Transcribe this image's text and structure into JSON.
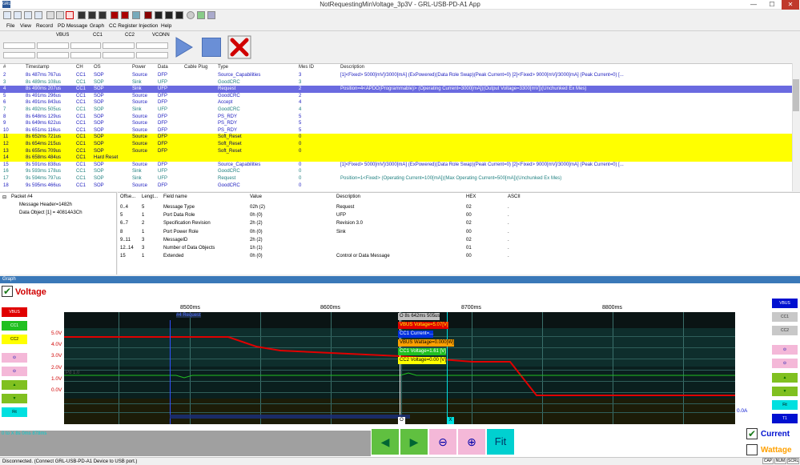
{
  "window": {
    "title": "NotRequestingMinVoltage_3p3V - GRL-USB-PD-A1 App",
    "icon_text": "GRL",
    "minimize": "—",
    "maximize": "☐",
    "close": "✕"
  },
  "menu": [
    "File",
    "View",
    "Record",
    "PD Message",
    "Graph",
    "CC Register Injection",
    "Help"
  ],
  "controls": {
    "labels": [
      "VBUS",
      "CC1",
      "CC2",
      "VCONN"
    ]
  },
  "table": {
    "headers": [
      "#",
      "Timestamp",
      "CH",
      "OS",
      "Power",
      "Data",
      "Cable Plug",
      "Type",
      "Mes ID",
      "Description"
    ],
    "rows": [
      {
        "n": "2",
        "ts": "8s 487ms 767us",
        "ch": "CC1",
        "os": "SOP",
        "power": "Source",
        "data": "DFP",
        "cable": "",
        "type": "Source_Capabilities",
        "mid": "3",
        "desc": "[1]<Fixed> 5000[mV]/3000[mA] (ExPowered)(Data Role Swap)(Peak Current=0) [2]<Fixed> 9000[mV]/3000[mA] (Peak Current=0) [...",
        "style": "blue"
      },
      {
        "n": "3",
        "ts": "8s 489ms 108us",
        "ch": "CC1",
        "os": "SOP",
        "power": "Sink",
        "data": "UFP",
        "cable": "",
        "type": "GoodCRC",
        "mid": "3",
        "desc": "",
        "style": "teal"
      },
      {
        "n": "4",
        "ts": "8s 490ms 207us",
        "ch": "CC1",
        "os": "SOP",
        "power": "Sink",
        "data": "UFP",
        "cable": "",
        "type": "Request",
        "mid": "2",
        "desc": "Position=4<APDO(Programmable)> (Operating Current=3000[mA])(Output Voltage=3300[mV])(Unchunked Ex Mes)",
        "style": "selected"
      },
      {
        "n": "5",
        "ts": "8s 491ms 296us",
        "ch": "CC1",
        "os": "SOP",
        "power": "Source",
        "data": "DFP",
        "cable": "",
        "type": "GoodCRC",
        "mid": "2",
        "desc": "",
        "style": "blue"
      },
      {
        "n": "6",
        "ts": "8s 491ms 843us",
        "ch": "CC1",
        "os": "SOP",
        "power": "Source",
        "data": "DFP",
        "cable": "",
        "type": "Accept",
        "mid": "4",
        "desc": "",
        "style": "blue"
      },
      {
        "n": "7",
        "ts": "8s 492ms 505us",
        "ch": "CC1",
        "os": "SOP",
        "power": "Sink",
        "data": "UFP",
        "cable": "",
        "type": "GoodCRC",
        "mid": "4",
        "desc": "",
        "style": "teal"
      },
      {
        "n": "8",
        "ts": "8s 648ms 129us",
        "ch": "CC1",
        "os": "SOP",
        "power": "Source",
        "data": "DFP",
        "cable": "",
        "type": "PS_RDY",
        "mid": "5",
        "desc": "",
        "style": "blue"
      },
      {
        "n": "9",
        "ts": "8s 649ms 622us",
        "ch": "CC1",
        "os": "SOP",
        "power": "Source",
        "data": "DFP",
        "cable": "",
        "type": "PS_RDY",
        "mid": "5",
        "desc": "",
        "style": "blue"
      },
      {
        "n": "10",
        "ts": "8s 651ms 116us",
        "ch": "CC1",
        "os": "SOP",
        "power": "Source",
        "data": "DFP",
        "cable": "",
        "type": "PS_RDY",
        "mid": "5",
        "desc": "",
        "style": "blue"
      },
      {
        "n": "11",
        "ts": "8s 652ms 721us",
        "ch": "CC1",
        "os": "SOP",
        "power": "Source",
        "data": "DFP",
        "cable": "",
        "type": "Soft_Reset",
        "mid": "0",
        "desc": "",
        "style": "yellow"
      },
      {
        "n": "12",
        "ts": "8s 654ms 215us",
        "ch": "CC1",
        "os": "SOP",
        "power": "Source",
        "data": "DFP",
        "cable": "",
        "type": "Soft_Reset",
        "mid": "0",
        "desc": "",
        "style": "yellow"
      },
      {
        "n": "13",
        "ts": "8s 655ms 709us",
        "ch": "CC1",
        "os": "SOP",
        "power": "Source",
        "data": "DFP",
        "cable": "",
        "type": "Soft_Reset",
        "mid": "0",
        "desc": "",
        "style": "yellow"
      },
      {
        "n": "14",
        "ts": "8s 658ms 484us",
        "ch": "CC1",
        "os": "Hard Reset",
        "power": "",
        "data": "",
        "cable": "",
        "type": "",
        "mid": "",
        "desc": "",
        "style": "yellow"
      },
      {
        "n": "15",
        "ts": "9s 591ms 838us",
        "ch": "CC1",
        "os": "SOP",
        "power": "Source",
        "data": "DFP",
        "cable": "",
        "type": "Source_Capabilities",
        "mid": "0",
        "desc": "[1]<Fixed> 5000[mV]/3000[mA] (ExPowered)(Data Role Swap)(Peak Current=0) [2]<Fixed> 9000[mV]/3000[mA] (Peak Current=0) [...",
        "style": "blue"
      },
      {
        "n": "16",
        "ts": "9s 593ms 178us",
        "ch": "CC1",
        "os": "SOP",
        "power": "Sink",
        "data": "UFP",
        "cable": "",
        "type": "GoodCRC",
        "mid": "0",
        "desc": "",
        "style": "teal"
      },
      {
        "n": "17",
        "ts": "9s 594ms 797us",
        "ch": "CC1",
        "os": "SOP",
        "power": "Sink",
        "data": "UFP",
        "cable": "",
        "type": "Request",
        "mid": "0",
        "desc": "Position=1<Fixed> (Operating Current=100[mA])(Max Operating Current=500[mA])(Unchunked Ex Mes)",
        "style": "teal"
      },
      {
        "n": "18",
        "ts": "9s 595ms 466us",
        "ch": "CC1",
        "os": "SOP",
        "power": "Source",
        "data": "DFP",
        "cable": "",
        "type": "GoodCRC",
        "mid": "0",
        "desc": "",
        "style": "blue"
      }
    ]
  },
  "tree": {
    "root": "Packet #4",
    "children": [
      "Message Header=1482h",
      "Data Object [1] = 40814A3Ch"
    ]
  },
  "fields": {
    "headers": [
      "Offse...",
      "Lengt...",
      "Field name",
      "Value",
      "Description",
      "HEX",
      "ASCII"
    ],
    "rows": [
      {
        "off": "0..4",
        "len": "5",
        "name": "Message Type",
        "val": "02h (2)",
        "desc": "Request",
        "hex": "02",
        "ascii": "."
      },
      {
        "off": "5",
        "len": "1",
        "name": "Port Data Role",
        "val": "0h (0)",
        "desc": "UFP",
        "hex": "00",
        "ascii": "."
      },
      {
        "off": "6..7",
        "len": "2",
        "name": "Specification Revision",
        "val": "2h (2)",
        "desc": "Revision 3.0",
        "hex": "02",
        "ascii": "."
      },
      {
        "off": "8",
        "len": "1",
        "name": "Port Power Role",
        "val": "0h (0)",
        "desc": "Sink",
        "hex": "00",
        "ascii": "."
      },
      {
        "off": "9..11",
        "len": "3",
        "name": "MessageID",
        "val": "2h (2)",
        "desc": "",
        "hex": "02",
        "ascii": "."
      },
      {
        "off": "12..14",
        "len": "3",
        "name": "Number of Data Objects",
        "val": "1h (1)",
        "desc": "",
        "hex": "01",
        "ascii": "."
      },
      {
        "off": "15",
        "len": "1",
        "name": "Extended",
        "val": "0h (0)",
        "desc": "Control or Data Message",
        "hex": "00",
        "ascii": "."
      }
    ]
  },
  "graph": {
    "header": "Graph",
    "voltage_label": "Voltage",
    "current_label": "Current",
    "wattage_label": "Wattage",
    "left_buttons": [
      "VBUS",
      "CC1",
      "CC2"
    ],
    "right_buttons": [
      "VBUS",
      "CC1",
      "CC2"
    ],
    "fit_label": "Fit",
    "t1_label": "T1",
    "x_ticks": [
      "8500ms",
      "8600ms",
      "8700ms",
      "8800ms"
    ],
    "y_ticks": [
      "5.0V",
      "4.0V",
      "3.0V",
      "2.0V",
      "1.0V",
      "0.0V"
    ],
    "marker_request": "#4 Request",
    "right_axis_label": "0.0A",
    "cursor_o": "O",
    "cursor_x": "X",
    "tooltips": [
      {
        "text": "O     8s 642ms 505us",
        "bg": "#c0c0c0",
        "fg": "#000"
      },
      {
        "text": "VBUS Voltage=5.07[V]",
        "bg": "#e00000",
        "fg": "#ff0"
      },
      {
        "text": "CC1 Current=...",
        "bg": "#0030e0",
        "fg": "#fff"
      },
      {
        "text": "VBUS Wattage=0.000[W]",
        "bg": "#ffa000",
        "fg": "#000"
      },
      {
        "text": "CC1 Voltage=1.61 [V]",
        "bg": "#20c020",
        "fg": "#fff"
      },
      {
        "text": "CC2 Voltage=0.00 [V]",
        "bg": "#ffff00",
        "fg": "#000"
      }
    ],
    "bottom_time": "0 to X      8s   0ms 878ms",
    "nav_fit": "Fit",
    "colors": {
      "vbus": "#e00000",
      "cc1": "#20c020",
      "cc2": "#ffff00",
      "accent": "#3a78b8"
    }
  },
  "status": {
    "text": "Disconnected.  (Connect GRL-USB-PD-A1 Device to USB port.)",
    "cap": "CAP",
    "num": "NUM",
    "scrl": "SCRL"
  }
}
